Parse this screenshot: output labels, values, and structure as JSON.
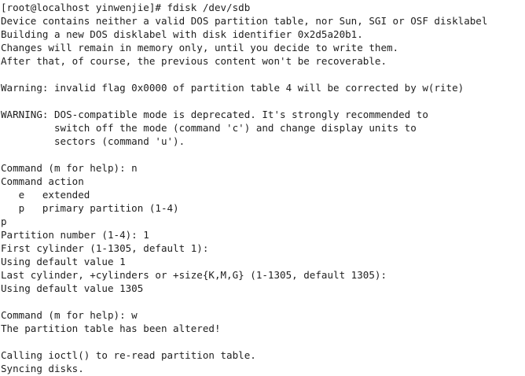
{
  "terminal": {
    "lines": [
      "[root@localhost yinwenjie]# fdisk /dev/sdb",
      "Device contains neither a valid DOS partition table, nor Sun, SGI or OSF disklabel",
      "Building a new DOS disklabel with disk identifier 0x2d5a20b1.",
      "Changes will remain in memory only, until you decide to write them.",
      "After that, of course, the previous content won't be recoverable.",
      "",
      "Warning: invalid flag 0x0000 of partition table 4 will be corrected by w(rite)",
      "",
      "WARNING: DOS-compatible mode is deprecated. It's strongly recommended to",
      "         switch off the mode (command 'c') and change display units to",
      "         sectors (command 'u').",
      "",
      "Command (m for help): n",
      "Command action",
      "   e   extended",
      "   p   primary partition (1-4)",
      "p",
      "Partition number (1-4): 1",
      "First cylinder (1-1305, default 1):",
      "Using default value 1",
      "Last cylinder, +cylinders or +size{K,M,G} (1-1305, default 1305):",
      "Using default value 1305",
      "",
      "Command (m for help): w",
      "The partition table has been altered!",
      "",
      "Calling ioctl() to re-read partition table.",
      "Syncing disks."
    ]
  }
}
